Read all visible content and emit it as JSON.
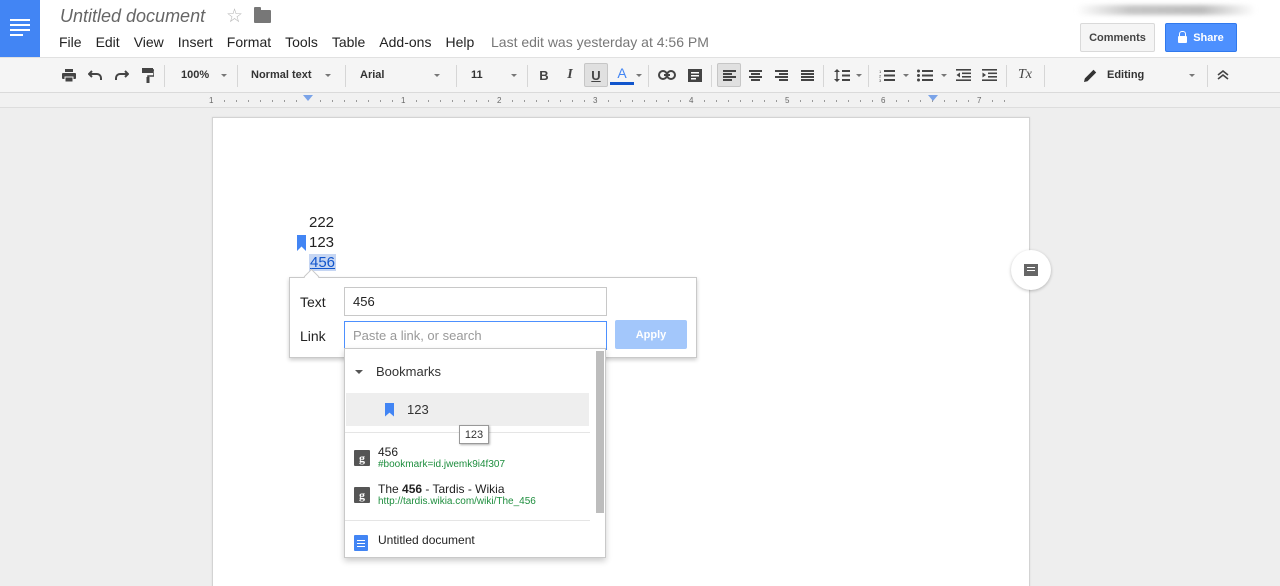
{
  "header": {
    "title": "Untitled document",
    "menu": [
      "File",
      "Edit",
      "View",
      "Insert",
      "Format",
      "Tools",
      "Table",
      "Add-ons",
      "Help"
    ],
    "last_edit": "Last edit was yesterday at 4:56 PM",
    "comments_label": "Comments",
    "share_label": "Share"
  },
  "toolbar": {
    "zoom": "100%",
    "style": "Normal text",
    "font": "Arial",
    "size": "11",
    "bold": "B",
    "italic": "I",
    "underline": "U",
    "text_color": "A",
    "clear_format": "Tx",
    "mode": "Editing"
  },
  "ruler": {
    "numbers": [
      "1",
      "1",
      "2",
      "3",
      "4",
      "5",
      "6",
      "7"
    ]
  },
  "document": {
    "lines": [
      "222",
      "123",
      "456"
    ]
  },
  "link_dialog": {
    "text_label": "Text",
    "text_value": "456",
    "link_label": "Link",
    "link_placeholder": "Paste a link, or search",
    "apply_label": "Apply"
  },
  "suggestions": {
    "bookmarks_header": "Bookmarks",
    "bookmark_item": "123",
    "tooltip": "123",
    "results": [
      {
        "title_pre": "",
        "title_bold": "456",
        "title_post": "",
        "url": "#bookmark=id.jwemk9i4f307"
      },
      {
        "title_pre": "The ",
        "title_bold": "456",
        "title_post": " - Tardis - Wikia",
        "url": "http://tardis.wikia.com/wiki/The_456"
      }
    ],
    "doc_result": "Untitled document"
  },
  "colors": {
    "accent": "#4285f4",
    "share": "#4d90fe",
    "link": "#1155cc",
    "url_green": "#1e8e3e"
  }
}
